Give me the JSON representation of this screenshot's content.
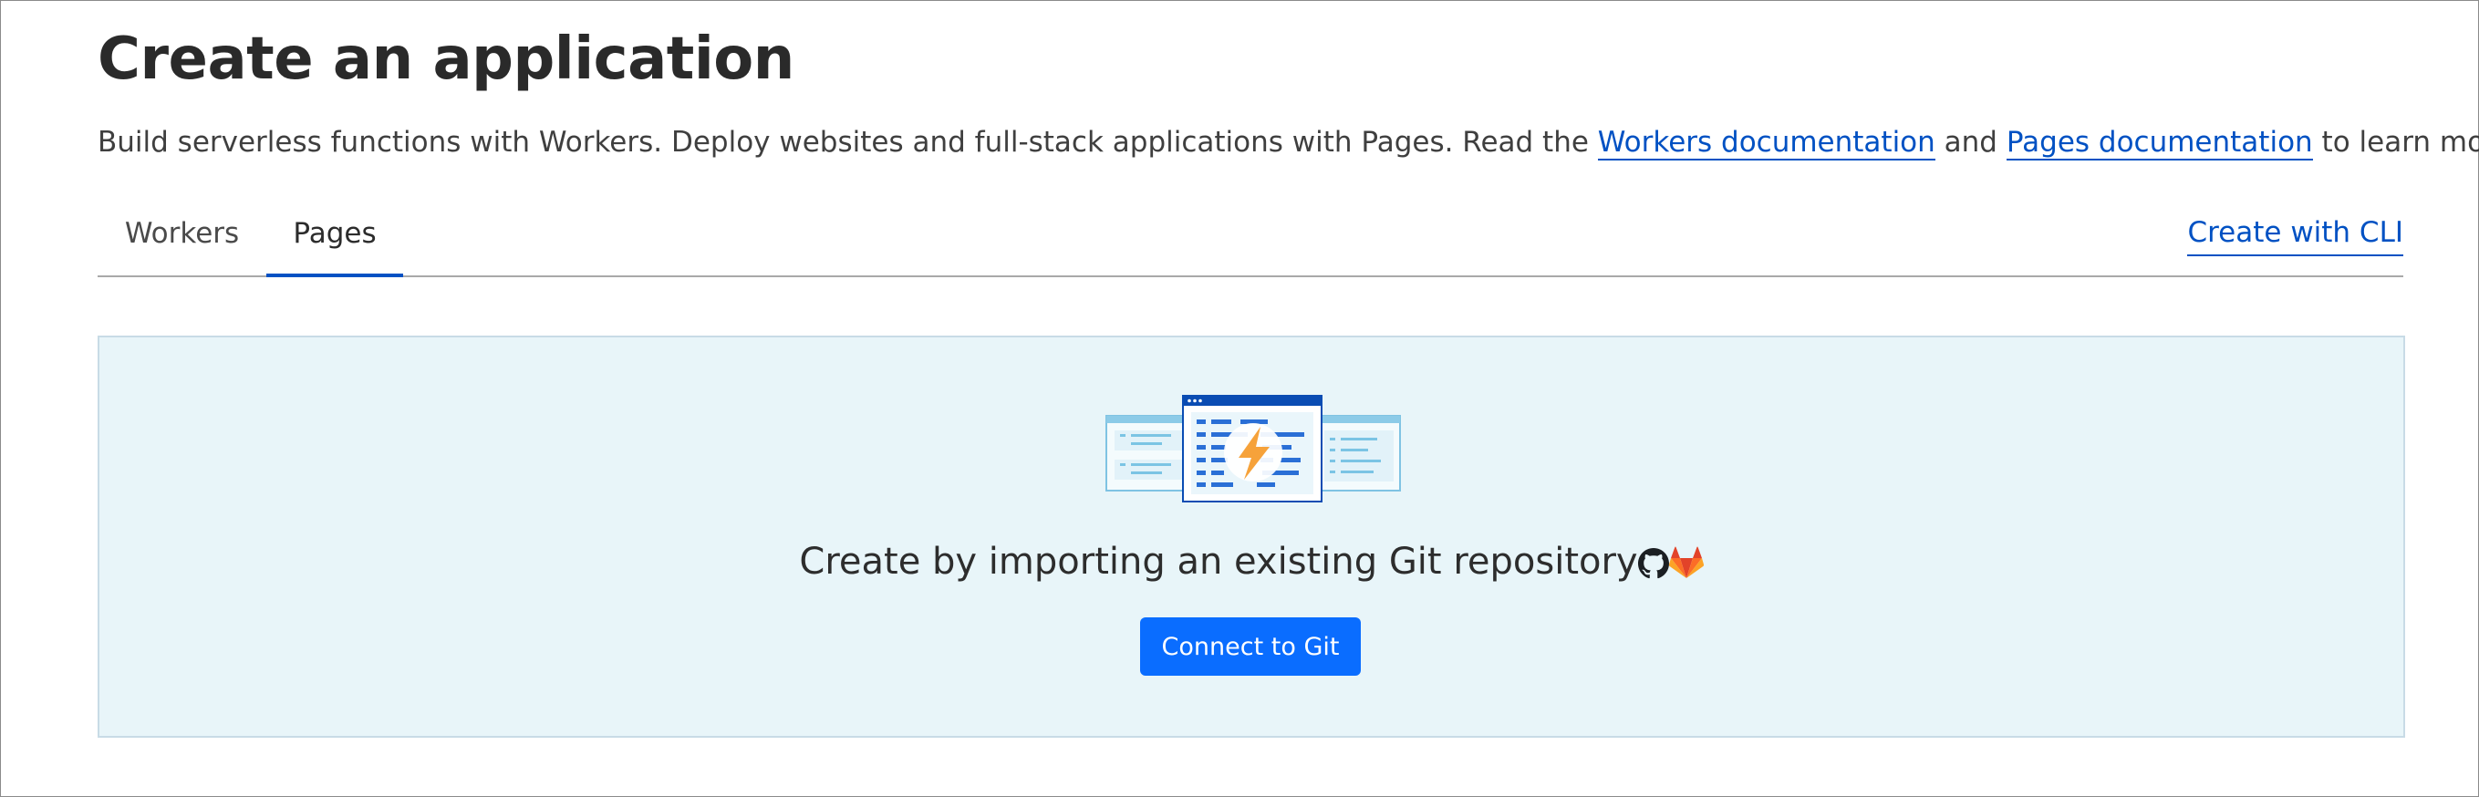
{
  "header": {
    "title": "Create an application",
    "description_prefix": "Build serverless functions with Workers. Deploy websites and full-stack applications with Pages. Read the ",
    "workers_doc_link": "Workers documentation",
    "description_and": " and ",
    "pages_doc_link": "Pages documentation",
    "description_suffix": " to learn more."
  },
  "tabs": [
    {
      "label": "Workers",
      "selected": false
    },
    {
      "label": "Pages",
      "selected": true
    }
  ],
  "create_with_cli": "Create with CLI",
  "git_panel": {
    "text": "Create by importing an existing Git repository",
    "icons": [
      "github-icon",
      "gitlab-icon"
    ],
    "button_label": "Connect to Git",
    "illustration": "pages-illustration"
  },
  "colors": {
    "accent": "#0051c3",
    "button": "#0a6dff",
    "panel_background": "#e8f5f9"
  }
}
